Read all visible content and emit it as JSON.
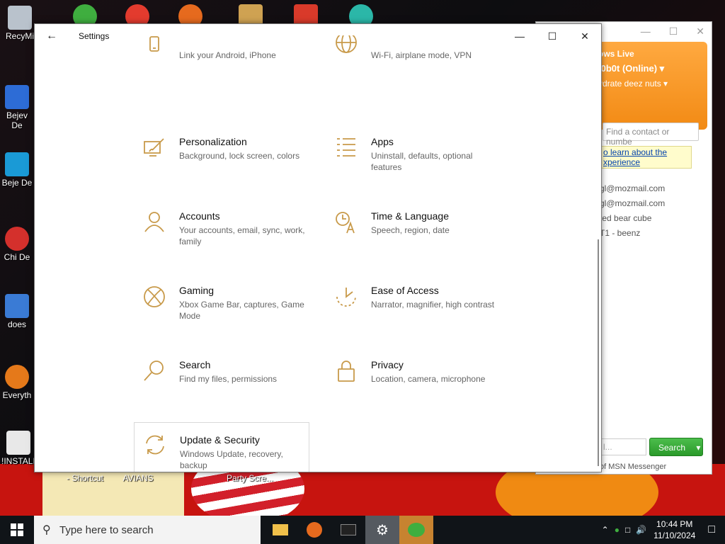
{
  "desktop": {
    "icons": [
      {
        "label": "RecyMi"
      },
      {
        "label": "Bejev De"
      },
      {
        "label": "Beje De"
      },
      {
        "label": "Chi De"
      },
      {
        "label": "does"
      },
      {
        "label": "Everyth"
      },
      {
        "label": "!INSTALL"
      }
    ],
    "bottom_labels": [
      "- Shortcut",
      "AVIANS",
      "Party Scre..."
    ]
  },
  "msn": {
    "brand": "ows Live",
    "status": "l0b0t  (Online) ▾",
    "psm": "ydrate deez nuts ▾",
    "search_placeholder": "Find a contact or numbe",
    "promo_line1": "o learn about the",
    "promo_line2": "xperience",
    "contacts": [
      "gl@mozmail.com",
      "gl@mozmail.com",
      "ted bear cube",
      "",
      "T1 - beenz"
    ],
    "bottom_search_text": "l...",
    "search_button": "Search",
    "footer": "of MSN Messenger"
  },
  "settings": {
    "title": "Settings",
    "back_icon": "arrow-left-icon",
    "tiles": [
      {
        "key": "phone",
        "name": "",
        "desc": "Link your Android, iPhone",
        "icon": "phone-icon"
      },
      {
        "key": "network",
        "name": "",
        "desc": "Wi-Fi, airplane mode, VPN",
        "icon": "globe-icon"
      },
      {
        "key": "personalization",
        "name": "Personalization",
        "desc": "Background, lock screen, colors",
        "icon": "paint-icon"
      },
      {
        "key": "apps",
        "name": "Apps",
        "desc": "Uninstall, defaults, optional features",
        "icon": "apps-list-icon"
      },
      {
        "key": "accounts",
        "name": "Accounts",
        "desc": "Your accounts, email, sync, work, family",
        "icon": "person-icon"
      },
      {
        "key": "time",
        "name": "Time & Language",
        "desc": "Speech, region, date",
        "icon": "time-language-icon"
      },
      {
        "key": "gaming",
        "name": "Gaming",
        "desc": "Xbox Game Bar, captures, Game Mode",
        "icon": "xbox-icon"
      },
      {
        "key": "ease",
        "name": "Ease of Access",
        "desc": "Narrator, magnifier, high contrast",
        "icon": "ease-of-access-icon"
      },
      {
        "key": "search",
        "name": "Search",
        "desc": "Find my files, permissions",
        "icon": "search-icon"
      },
      {
        "key": "privacy",
        "name": "Privacy",
        "desc": "Location, camera, microphone",
        "icon": "lock-icon"
      },
      {
        "key": "update",
        "name": "Update & Security",
        "desc": "Windows Update, recovery, backup",
        "icon": "refresh-icon"
      }
    ]
  },
  "taskbar": {
    "search_placeholder": "Type here to search",
    "time": "10:44 PM",
    "date": "11/10/2024"
  }
}
